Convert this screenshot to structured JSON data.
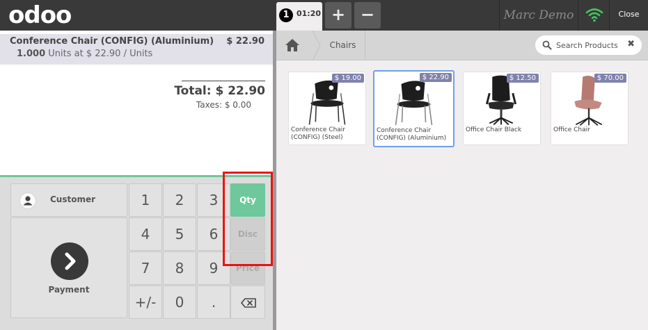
{
  "header": {
    "logo": "odoo",
    "order_number": "1",
    "order_time": "01:20",
    "add_order_label": "+",
    "remove_order_label": "−",
    "username": "Marc Demo",
    "close_label": "Close",
    "wifi_color": "#47c15f"
  },
  "order": {
    "line": {
      "name": "Conference Chair (CONFIG) (Aluminium)",
      "price": "$ 22.90",
      "quantity": "1.000",
      "unit_text": "Units at $ 22.90 / Units"
    },
    "total": "Total: $ 22.90",
    "taxes": "Taxes: $ 0.00"
  },
  "numpad": {
    "customer_label": "Customer",
    "payment_label": "Payment",
    "keys": [
      "1",
      "2",
      "3",
      "4",
      "5",
      "6",
      "7",
      "8",
      "9",
      "+/-",
      "0",
      "."
    ],
    "modes": {
      "qty": "Qty",
      "disc": "Disc",
      "price": "Price"
    },
    "active_mode": "Qty",
    "accent_color": "#6ec89b"
  },
  "products": {
    "breadcrumb": "Chairs",
    "search_placeholder": "Search Products",
    "clear_label": "✖",
    "items": [
      {
        "name": "Conference Chair (CONFIG) (Steel)",
        "price": "$ 19.00"
      },
      {
        "name": "Conference Chair (CONFIG) (Aluminium)",
        "price": "$ 22.90"
      },
      {
        "name": "Office Chair Black",
        "price": "$ 12.50"
      },
      {
        "name": "Office Chair",
        "price": "$ 70.00"
      }
    ]
  }
}
